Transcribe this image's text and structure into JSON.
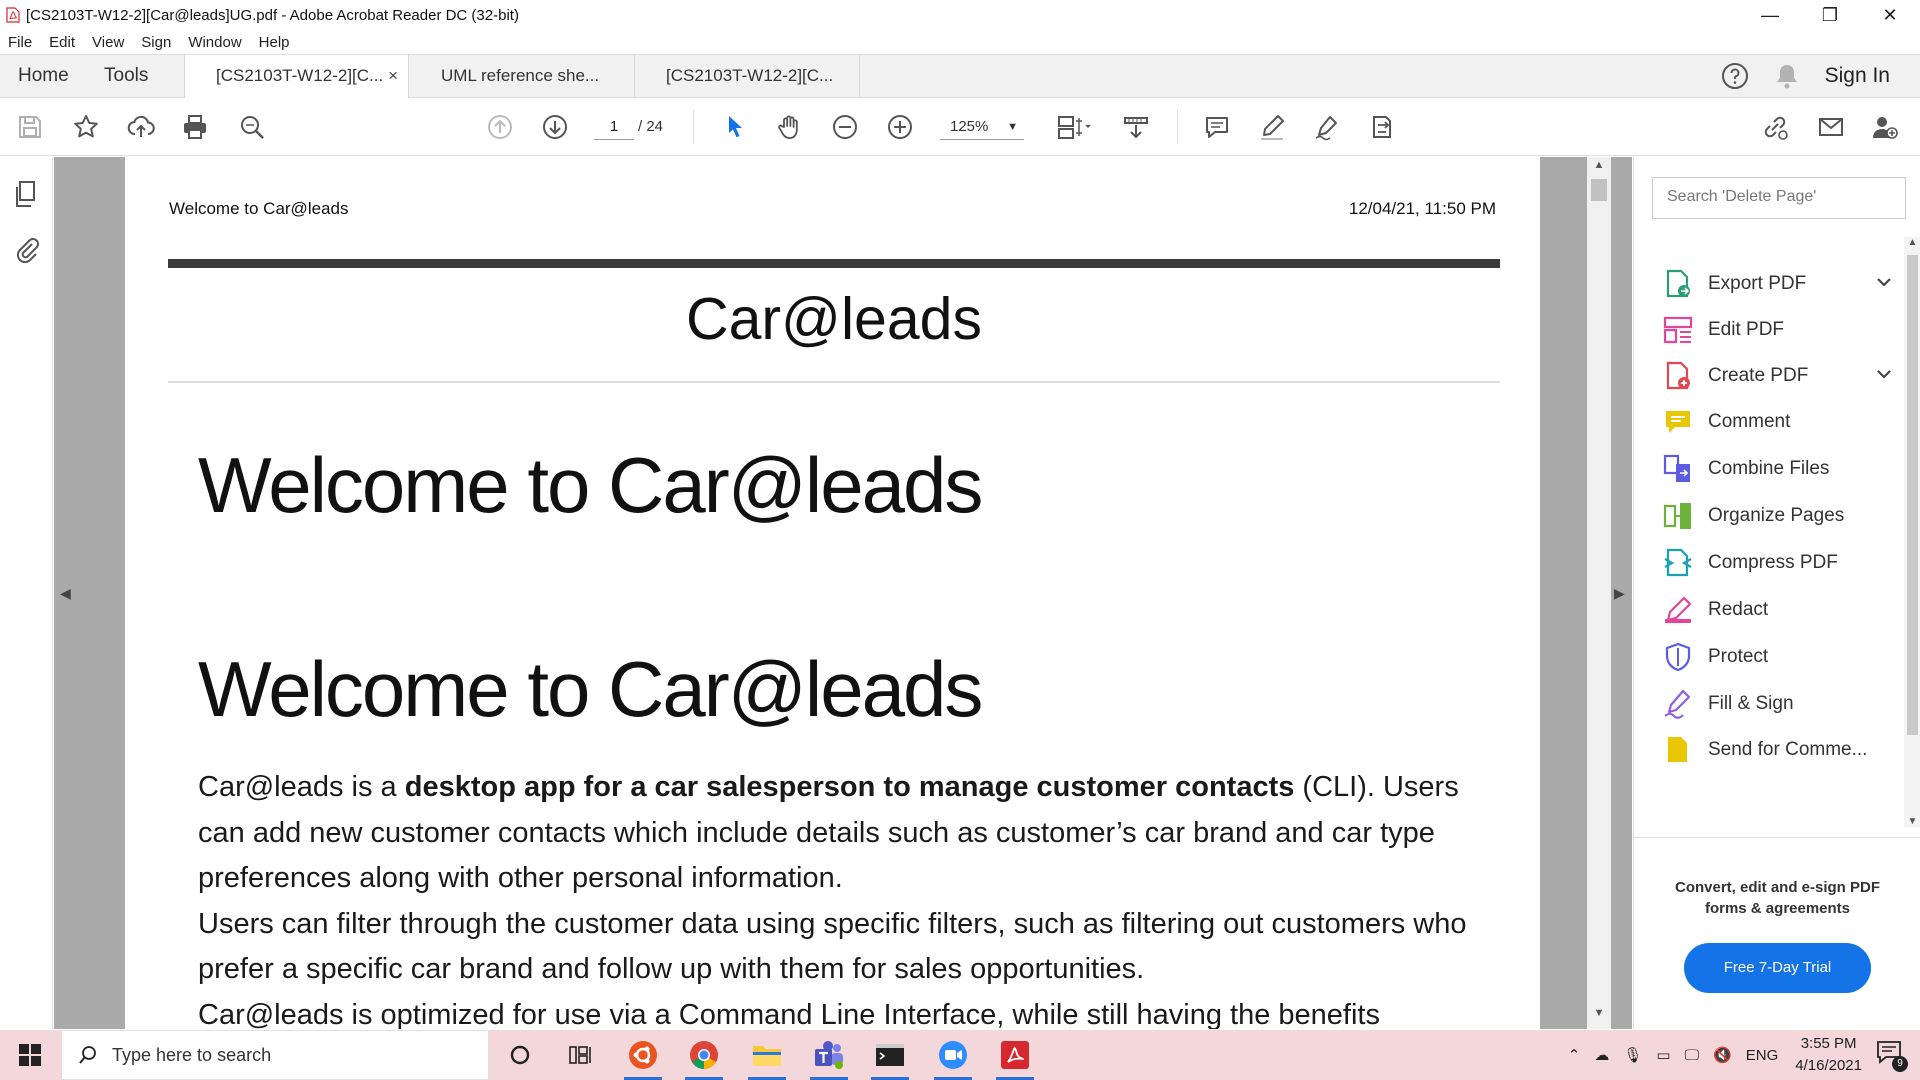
{
  "window": {
    "title": "[CS2103T-W12-2][Car@leads]UG.pdf - Adobe Acrobat Reader DC (32-bit)",
    "minimize": "—",
    "restore": "❐",
    "close": "✕"
  },
  "menu": [
    "File",
    "Edit",
    "View",
    "Sign",
    "Window",
    "Help"
  ],
  "tabs": {
    "home": "Home",
    "tools": "Tools",
    "documents": [
      {
        "label": "[CS2103T-W12-2][C...",
        "close": "×"
      },
      {
        "label": "UML reference she..."
      },
      {
        "label": "[CS2103T-W12-2][C..."
      }
    ],
    "sign_in": "Sign In"
  },
  "toolbar": {
    "page_current": "1",
    "page_total": "/  24",
    "zoom": "125%"
  },
  "document": {
    "header_left": "Welcome to Car@leads",
    "header_right": "12/04/21, 11:50 PM",
    "title": "Car@leads",
    "heading_1": "Welcome to Car@leads",
    "heading_2": "Welcome to Car@leads",
    "para_1_pre": "Car@leads is a ",
    "para_1_bold": "desktop app for a car salesperson to manage customer contacts",
    "para_1_post": " (CLI). Users can add new customer contacts which include details such as customer’s car brand and car type preferences along with other personal information.",
    "para_2": "Users can filter through the customer data using specific filters, such as filtering out customers who prefer a specific car brand and follow up with them for sales opportunities.",
    "para_3": "Car@leads is optimized for use via a Command Line Interface, while still having the benefits"
  },
  "tools_pane": {
    "search_placeholder": "Search 'Delete Page'",
    "items": [
      {
        "label": "Export PDF",
        "icon": "export-pdf-icon",
        "color": "#2d9d78"
      },
      {
        "label": "Edit PDF",
        "icon": "edit-pdf-icon",
        "color": "#e3459b"
      },
      {
        "label": "Create PDF",
        "icon": "create-pdf-icon",
        "color": "#e34850"
      },
      {
        "label": "Comment",
        "icon": "comment-icon",
        "color": "#e8c600"
      },
      {
        "label": "Combine Files",
        "icon": "combine-files-icon",
        "color": "#5c5ce0"
      },
      {
        "label": "Organize Pages",
        "icon": "organize-pages-icon",
        "color": "#6bb33a"
      },
      {
        "label": "Compress PDF",
        "icon": "compress-pdf-icon",
        "color": "#17a2b8"
      },
      {
        "label": "Redact",
        "icon": "redact-icon",
        "color": "#e3459b"
      },
      {
        "label": "Protect",
        "icon": "protect-icon",
        "color": "#5c5ce0"
      },
      {
        "label": "Fill & Sign",
        "icon": "fill-sign-icon",
        "color": "#8f5fe0"
      },
      {
        "label": "Send for Comme...",
        "icon": "send-for-comment-icon",
        "color": "#e8c600"
      }
    ],
    "promo": "Convert, edit and e-sign PDF forms & agreements",
    "trial_button": "Free 7-Day Trial"
  },
  "taskbar": {
    "search_placeholder": "Type here to search",
    "language": "ENG",
    "time": "3:55 PM",
    "date": "4/16/2021",
    "notifications": "9"
  },
  "colors": {
    "accent": "#1473e6",
    "acrobat_red": "#d7282f",
    "taskbar": "#f3d7db"
  }
}
